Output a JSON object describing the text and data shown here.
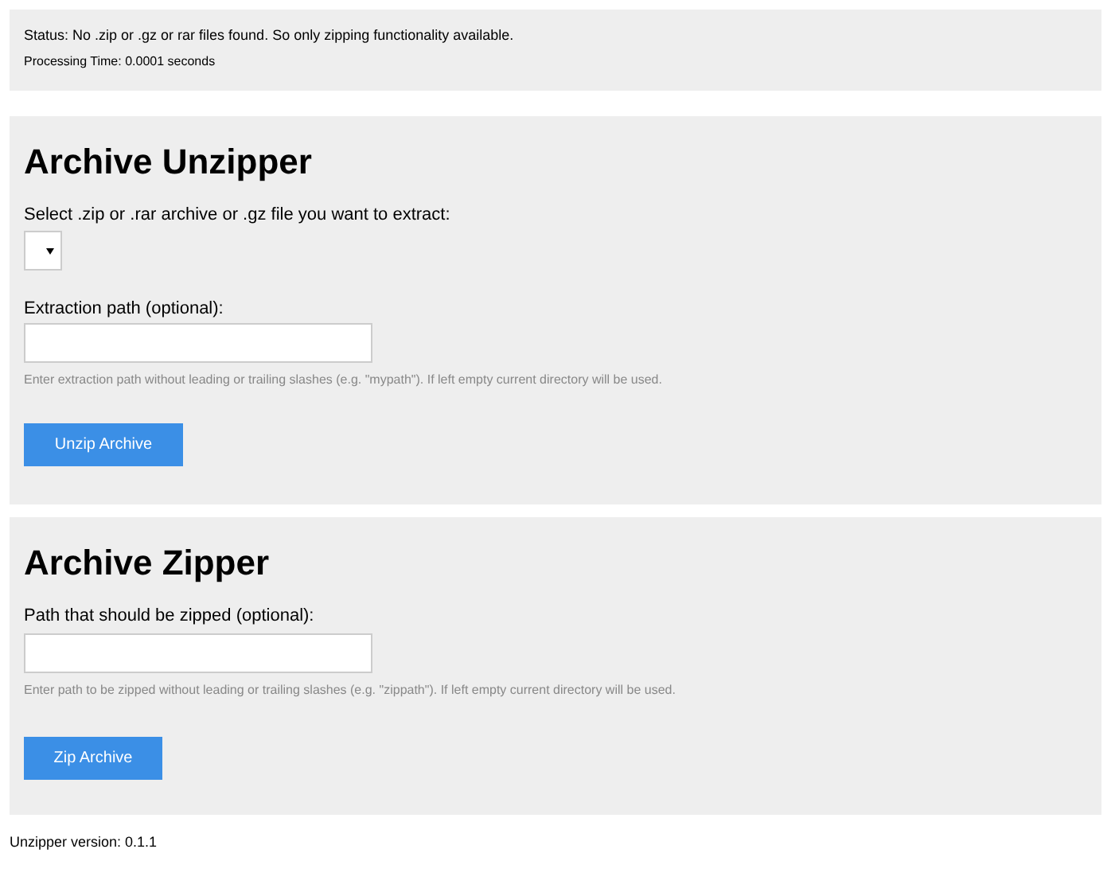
{
  "status": {
    "message": "Status: No .zip or .gz or rar files found. So only zipping functionality available.",
    "processing_time": "Processing Time: 0.0001 seconds"
  },
  "unzipper": {
    "title": "Archive Unzipper",
    "select_label": "Select .zip or .rar archive or .gz file you want to extract:",
    "path_label": "Extraction path (optional):",
    "hint": "Enter extraction path without leading or trailing slashes (e.g. \"mypath\"). If left empty current directory will be used.",
    "button": "Unzip Archive"
  },
  "zipper": {
    "title": "Archive Zipper",
    "path_label": "Path that should be zipped (optional):",
    "hint": "Enter path to be zipped without leading or trailing slashes (e.g. \"zippath\"). If left empty current directory will be used.",
    "button": "Zip Archive"
  },
  "footer": "Unzipper version: 0.1.1"
}
